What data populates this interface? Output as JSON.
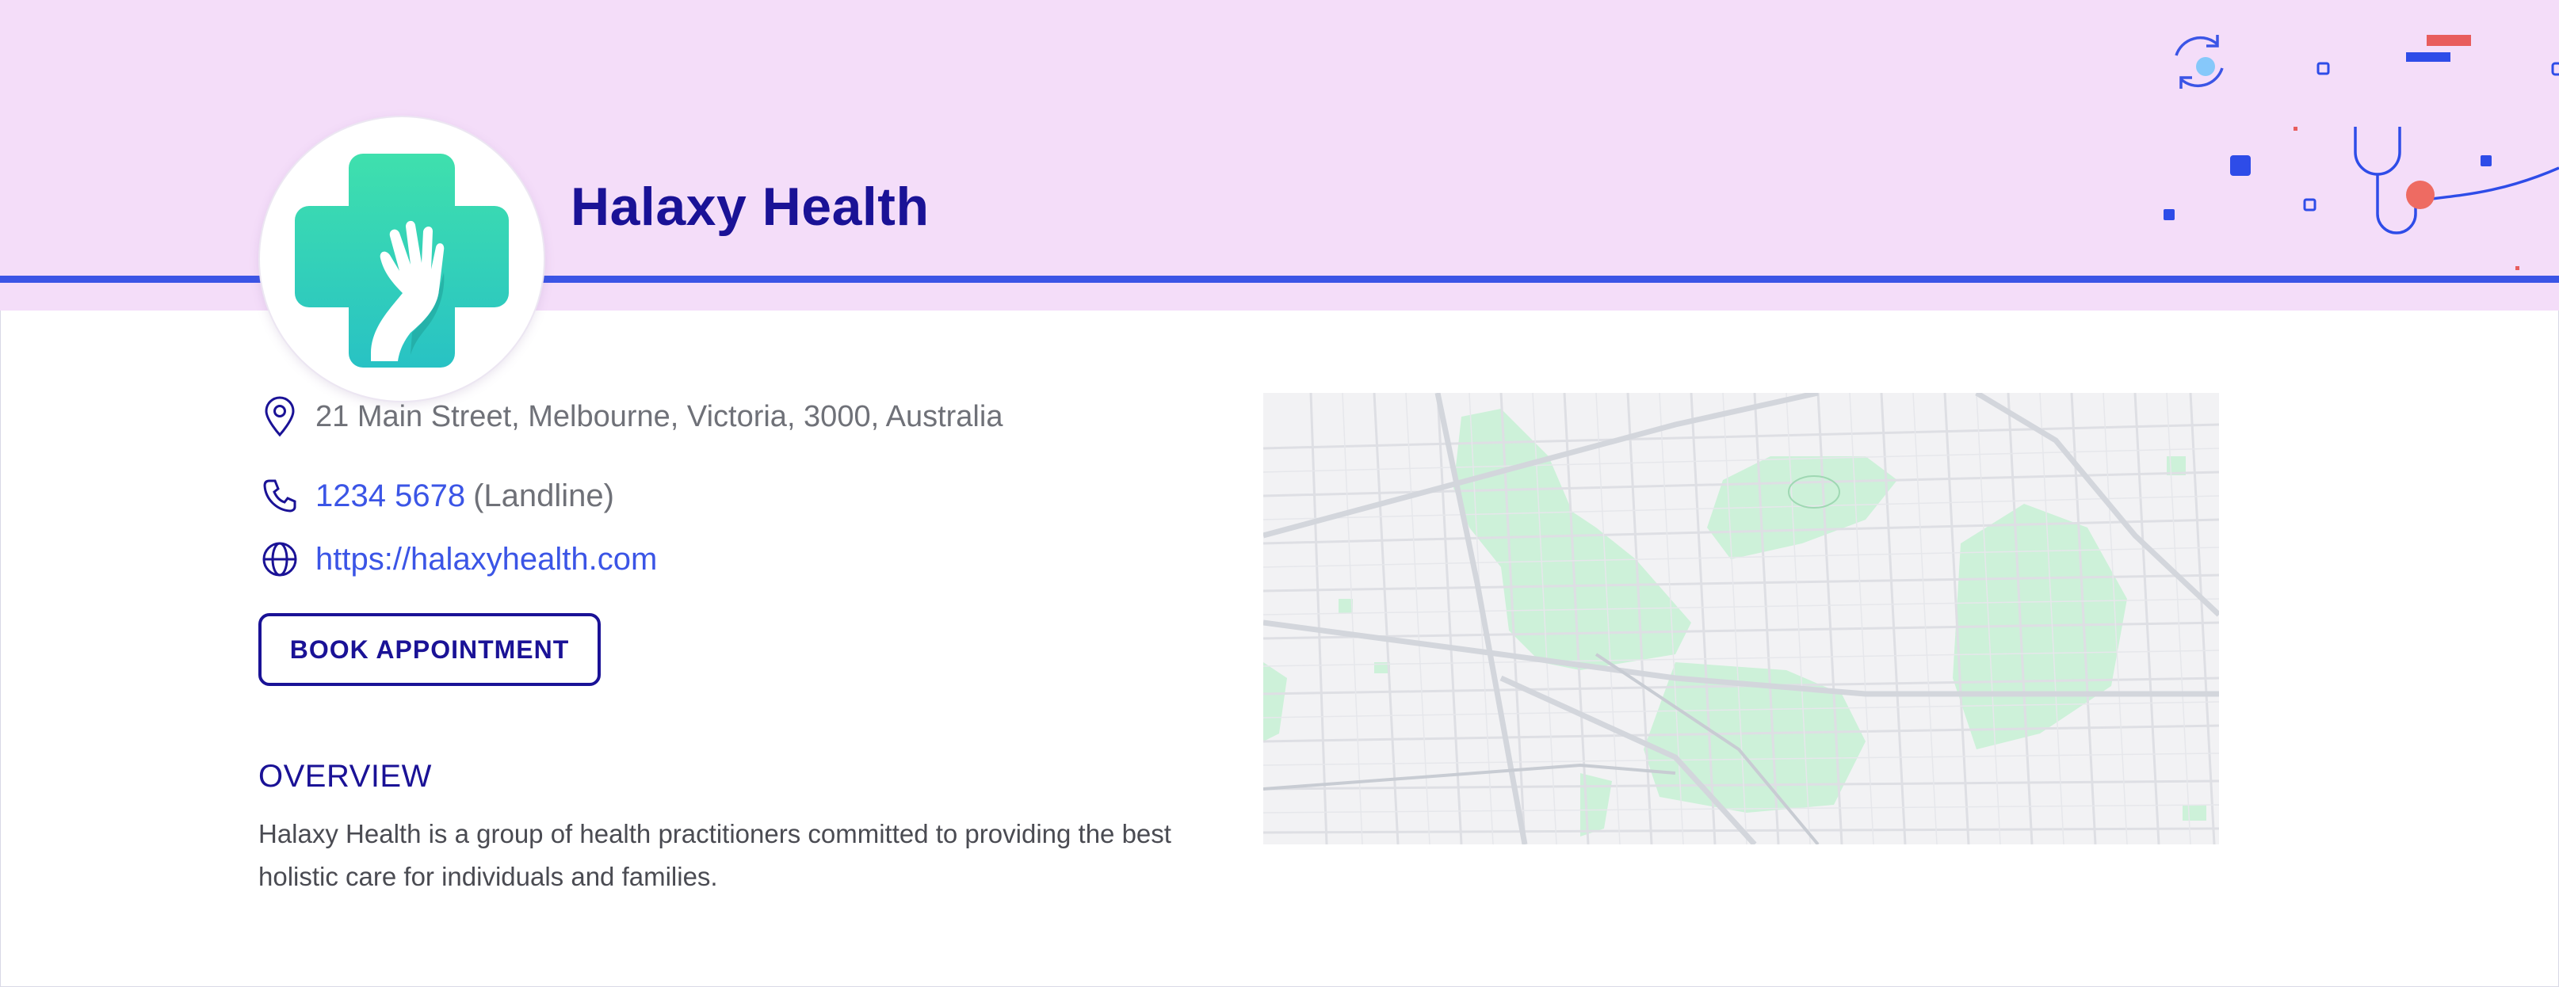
{
  "clinic": {
    "name": "Halaxy Health",
    "logo_icon": "medical-cross-hand-icon"
  },
  "contact": {
    "address": "21 Main Street, Melbourne, Victoria, 3000, Australia",
    "address_icon": "location-pin-icon",
    "phone": "1234 5678",
    "phone_type": "(Landline)",
    "phone_icon": "phone-icon",
    "website": "https://halaxyhealth.com",
    "website_icon": "globe-icon"
  },
  "actions": {
    "book_label": "BOOK APPOINTMENT"
  },
  "overview": {
    "heading": "OVERVIEW",
    "text": "Halaxy Health is a group of health practitioners committed to providing the best holistic care for individuals and families."
  },
  "colors": {
    "banner_bg": "#f4ddf9",
    "accent_blue": "#3b55e6",
    "brand_navy": "#1a1296",
    "brand_teal": "#2dd4b0",
    "park_green": "#cdf1d9"
  }
}
